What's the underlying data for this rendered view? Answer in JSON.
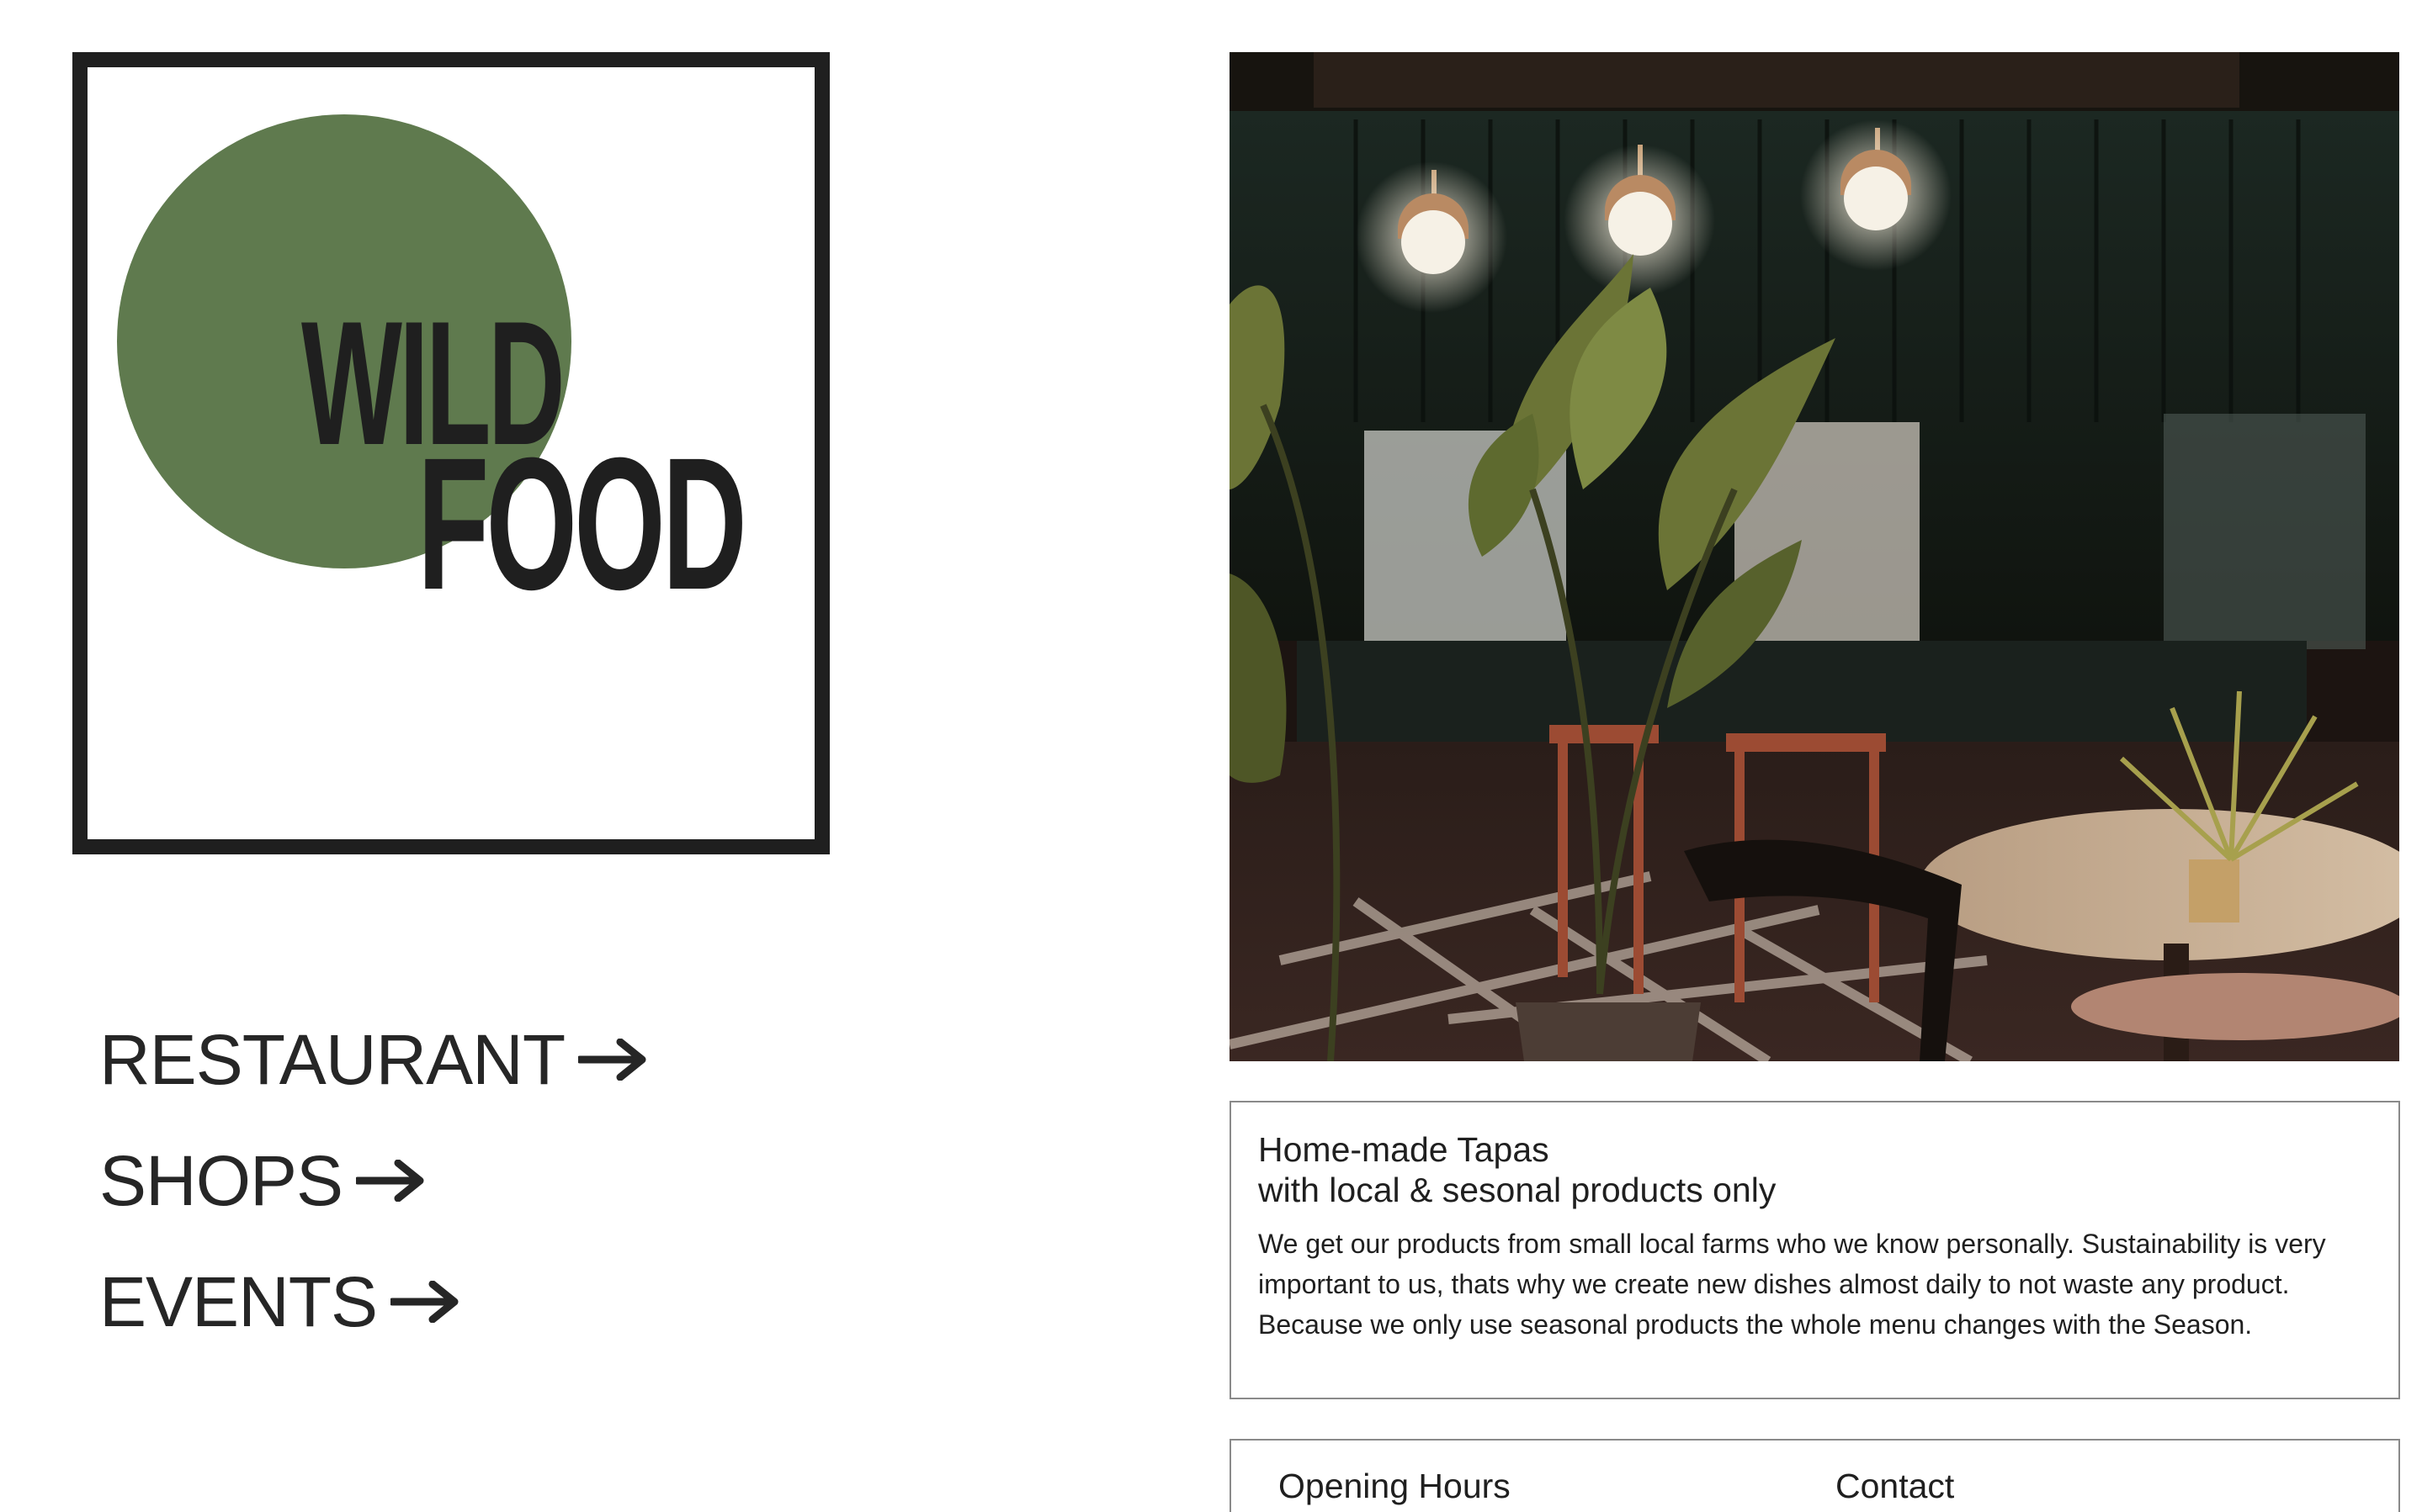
{
  "brand": {
    "logo_line1": "WILD",
    "logo_line2": "FOOD",
    "circle_color": "#5f7a4e",
    "ink_color": "#1f1f1f"
  },
  "nav": {
    "items": [
      {
        "label": "RESTAURANT",
        "icon": "arrow-right-icon"
      },
      {
        "label": "SHOPS",
        "icon": "arrow-right-icon"
      },
      {
        "label": "EVENTS",
        "icon": "arrow-right-icon"
      }
    ]
  },
  "hero_image": {
    "icon": "restaurant-interior-photo"
  },
  "info": {
    "title_line1": "Home-made Tapas",
    "title_line2": "with local & sesonal products only",
    "body_line1": "We get our products from small local farms who we know personally. Sustainability is very",
    "body_line2": "important to us, thats why we create new dishes almost daily to not waste any product.",
    "body_line3": "Because we only use seasonal products the whole menu changes with the Season."
  },
  "footer": {
    "opening_hours_heading": "Opening Hours",
    "contact_heading": "Contact"
  }
}
